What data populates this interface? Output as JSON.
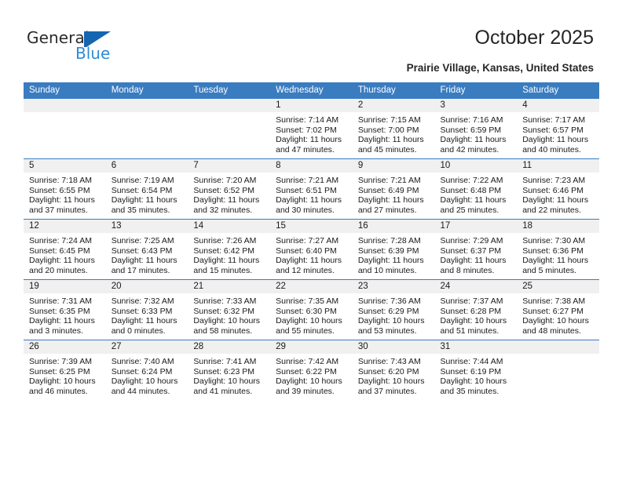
{
  "brand": {
    "name_part1": "General",
    "name_part2": "Blue",
    "flag_icon": "general-blue-flag-logo"
  },
  "header": {
    "title": "October 2025",
    "location": "Prairie Village, Kansas, United States"
  },
  "calendar": {
    "weekday_headers": [
      "Sunday",
      "Monday",
      "Tuesday",
      "Wednesday",
      "Thursday",
      "Friday",
      "Saturday"
    ],
    "accent_color": "#3a7cc0",
    "daynum_band_color": "#f0f0f0",
    "weeks": [
      [
        {
          "day": "",
          "sunrise": "",
          "sunset": "",
          "daylight_line1": "",
          "daylight_line2": "",
          "empty": true
        },
        {
          "day": "",
          "sunrise": "",
          "sunset": "",
          "daylight_line1": "",
          "daylight_line2": "",
          "empty": true
        },
        {
          "day": "",
          "sunrise": "",
          "sunset": "",
          "daylight_line1": "",
          "daylight_line2": "",
          "empty": true
        },
        {
          "day": "1",
          "sunrise": "Sunrise: 7:14 AM",
          "sunset": "Sunset: 7:02 PM",
          "daylight_line1": "Daylight: 11 hours",
          "daylight_line2": "and 47 minutes."
        },
        {
          "day": "2",
          "sunrise": "Sunrise: 7:15 AM",
          "sunset": "Sunset: 7:00 PM",
          "daylight_line1": "Daylight: 11 hours",
          "daylight_line2": "and 45 minutes."
        },
        {
          "day": "3",
          "sunrise": "Sunrise: 7:16 AM",
          "sunset": "Sunset: 6:59 PM",
          "daylight_line1": "Daylight: 11 hours",
          "daylight_line2": "and 42 minutes."
        },
        {
          "day": "4",
          "sunrise": "Sunrise: 7:17 AM",
          "sunset": "Sunset: 6:57 PM",
          "daylight_line1": "Daylight: 11 hours",
          "daylight_line2": "and 40 minutes."
        }
      ],
      [
        {
          "day": "5",
          "sunrise": "Sunrise: 7:18 AM",
          "sunset": "Sunset: 6:55 PM",
          "daylight_line1": "Daylight: 11 hours",
          "daylight_line2": "and 37 minutes."
        },
        {
          "day": "6",
          "sunrise": "Sunrise: 7:19 AM",
          "sunset": "Sunset: 6:54 PM",
          "daylight_line1": "Daylight: 11 hours",
          "daylight_line2": "and 35 minutes."
        },
        {
          "day": "7",
          "sunrise": "Sunrise: 7:20 AM",
          "sunset": "Sunset: 6:52 PM",
          "daylight_line1": "Daylight: 11 hours",
          "daylight_line2": "and 32 minutes."
        },
        {
          "day": "8",
          "sunrise": "Sunrise: 7:21 AM",
          "sunset": "Sunset: 6:51 PM",
          "daylight_line1": "Daylight: 11 hours",
          "daylight_line2": "and 30 minutes."
        },
        {
          "day": "9",
          "sunrise": "Sunrise: 7:21 AM",
          "sunset": "Sunset: 6:49 PM",
          "daylight_line1": "Daylight: 11 hours",
          "daylight_line2": "and 27 minutes."
        },
        {
          "day": "10",
          "sunrise": "Sunrise: 7:22 AM",
          "sunset": "Sunset: 6:48 PM",
          "daylight_line1": "Daylight: 11 hours",
          "daylight_line2": "and 25 minutes."
        },
        {
          "day": "11",
          "sunrise": "Sunrise: 7:23 AM",
          "sunset": "Sunset: 6:46 PM",
          "daylight_line1": "Daylight: 11 hours",
          "daylight_line2": "and 22 minutes."
        }
      ],
      [
        {
          "day": "12",
          "sunrise": "Sunrise: 7:24 AM",
          "sunset": "Sunset: 6:45 PM",
          "daylight_line1": "Daylight: 11 hours",
          "daylight_line2": "and 20 minutes."
        },
        {
          "day": "13",
          "sunrise": "Sunrise: 7:25 AM",
          "sunset": "Sunset: 6:43 PM",
          "daylight_line1": "Daylight: 11 hours",
          "daylight_line2": "and 17 minutes."
        },
        {
          "day": "14",
          "sunrise": "Sunrise: 7:26 AM",
          "sunset": "Sunset: 6:42 PM",
          "daylight_line1": "Daylight: 11 hours",
          "daylight_line2": "and 15 minutes."
        },
        {
          "day": "15",
          "sunrise": "Sunrise: 7:27 AM",
          "sunset": "Sunset: 6:40 PM",
          "daylight_line1": "Daylight: 11 hours",
          "daylight_line2": "and 12 minutes."
        },
        {
          "day": "16",
          "sunrise": "Sunrise: 7:28 AM",
          "sunset": "Sunset: 6:39 PM",
          "daylight_line1": "Daylight: 11 hours",
          "daylight_line2": "and 10 minutes."
        },
        {
          "day": "17",
          "sunrise": "Sunrise: 7:29 AM",
          "sunset": "Sunset: 6:37 PM",
          "daylight_line1": "Daylight: 11 hours",
          "daylight_line2": "and 8 minutes."
        },
        {
          "day": "18",
          "sunrise": "Sunrise: 7:30 AM",
          "sunset": "Sunset: 6:36 PM",
          "daylight_line1": "Daylight: 11 hours",
          "daylight_line2": "and 5 minutes."
        }
      ],
      [
        {
          "day": "19",
          "sunrise": "Sunrise: 7:31 AM",
          "sunset": "Sunset: 6:35 PM",
          "daylight_line1": "Daylight: 11 hours",
          "daylight_line2": "and 3 minutes."
        },
        {
          "day": "20",
          "sunrise": "Sunrise: 7:32 AM",
          "sunset": "Sunset: 6:33 PM",
          "daylight_line1": "Daylight: 11 hours",
          "daylight_line2": "and 0 minutes."
        },
        {
          "day": "21",
          "sunrise": "Sunrise: 7:33 AM",
          "sunset": "Sunset: 6:32 PM",
          "daylight_line1": "Daylight: 10 hours",
          "daylight_line2": "and 58 minutes."
        },
        {
          "day": "22",
          "sunrise": "Sunrise: 7:35 AM",
          "sunset": "Sunset: 6:30 PM",
          "daylight_line1": "Daylight: 10 hours",
          "daylight_line2": "and 55 minutes."
        },
        {
          "day": "23",
          "sunrise": "Sunrise: 7:36 AM",
          "sunset": "Sunset: 6:29 PM",
          "daylight_line1": "Daylight: 10 hours",
          "daylight_line2": "and 53 minutes."
        },
        {
          "day": "24",
          "sunrise": "Sunrise: 7:37 AM",
          "sunset": "Sunset: 6:28 PM",
          "daylight_line1": "Daylight: 10 hours",
          "daylight_line2": "and 51 minutes."
        },
        {
          "day": "25",
          "sunrise": "Sunrise: 7:38 AM",
          "sunset": "Sunset: 6:27 PM",
          "daylight_line1": "Daylight: 10 hours",
          "daylight_line2": "and 48 minutes."
        }
      ],
      [
        {
          "day": "26",
          "sunrise": "Sunrise: 7:39 AM",
          "sunset": "Sunset: 6:25 PM",
          "daylight_line1": "Daylight: 10 hours",
          "daylight_line2": "and 46 minutes."
        },
        {
          "day": "27",
          "sunrise": "Sunrise: 7:40 AM",
          "sunset": "Sunset: 6:24 PM",
          "daylight_line1": "Daylight: 10 hours",
          "daylight_line2": "and 44 minutes."
        },
        {
          "day": "28",
          "sunrise": "Sunrise: 7:41 AM",
          "sunset": "Sunset: 6:23 PM",
          "daylight_line1": "Daylight: 10 hours",
          "daylight_line2": "and 41 minutes."
        },
        {
          "day": "29",
          "sunrise": "Sunrise: 7:42 AM",
          "sunset": "Sunset: 6:22 PM",
          "daylight_line1": "Daylight: 10 hours",
          "daylight_line2": "and 39 minutes."
        },
        {
          "day": "30",
          "sunrise": "Sunrise: 7:43 AM",
          "sunset": "Sunset: 6:20 PM",
          "daylight_line1": "Daylight: 10 hours",
          "daylight_line2": "and 37 minutes."
        },
        {
          "day": "31",
          "sunrise": "Sunrise: 7:44 AM",
          "sunset": "Sunset: 6:19 PM",
          "daylight_line1": "Daylight: 10 hours",
          "daylight_line2": "and 35 minutes."
        },
        {
          "day": "",
          "sunrise": "",
          "sunset": "",
          "daylight_line1": "",
          "daylight_line2": "",
          "empty": true
        }
      ]
    ]
  }
}
